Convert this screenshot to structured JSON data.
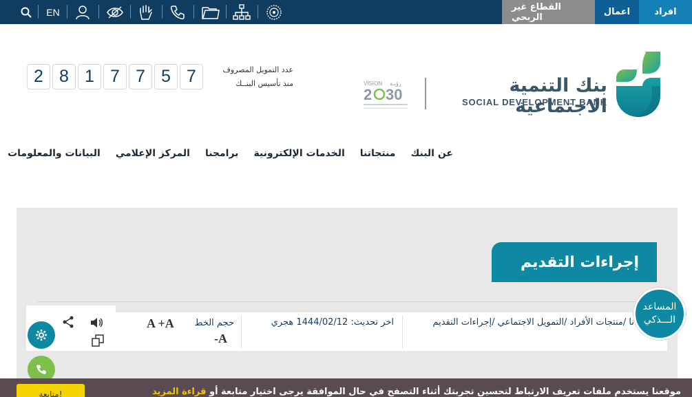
{
  "top_bar": {
    "segments": [
      "افراد",
      "اعمال",
      "القطاع غير الربحي"
    ],
    "language": "EN",
    "icons": [
      "search-icon",
      "user-icon",
      "eye-slash-icon",
      "sign-language-icon",
      "phone-icon",
      "folder-icon",
      "sitemap-icon",
      "seal-icon"
    ]
  },
  "header": {
    "bank_name_ar": "بنك التنمية الاجتماعية",
    "bank_name_en": "SOCIAL DEVELOPMENT BANK",
    "vision_text": "VISION 2030",
    "counter_label_1": "عدد التمويل المصروف",
    "counter_label_2": "منذ تأسيس البنــك",
    "counter_digits": [
      "2",
      "8",
      "1",
      "7",
      "7",
      "5",
      "7"
    ]
  },
  "nav": {
    "items": [
      "عن البنك",
      "منتجاتنا",
      "الخدمات الإلكترونية",
      "برامجنا",
      "المركز الإعلامي",
      "البيانات والمعلومات"
    ]
  },
  "page": {
    "title": "إجراءات التقديم",
    "breadcrumb": [
      "منتجات الأفراد",
      "التمويل الاجتماعي",
      "إجراءات التقديم"
    ],
    "breadcrumb_prefix": "نا /",
    "updated": "اخر تحديث: 1444/02/12 هجري",
    "font_size_label": "حجم الخط",
    "font_increase": "A +A",
    "font_decrease": "-A"
  },
  "assistant": {
    "line1": "المساعد",
    "line2": "الـــذكي"
  },
  "cookie": {
    "text": "موقعنا يستخدم ملفات تعريف الارتباط لتحسين تجربتك أثناء التصفح في حال الموافقة يرجى اختيار متابعة أو",
    "more_link": "قراءة المزيد",
    "continue_button": "متابعة!"
  },
  "colors": {
    "top_bar": "#0f3c5f",
    "tab_individuals": "#1480b5",
    "tab_business": "#0f5f96",
    "tab_nonprofit": "#8c8c8c",
    "accent_teal": "#0e88a3",
    "cookie_bg": "#5a4a52",
    "cookie_button": "#f5d300"
  }
}
